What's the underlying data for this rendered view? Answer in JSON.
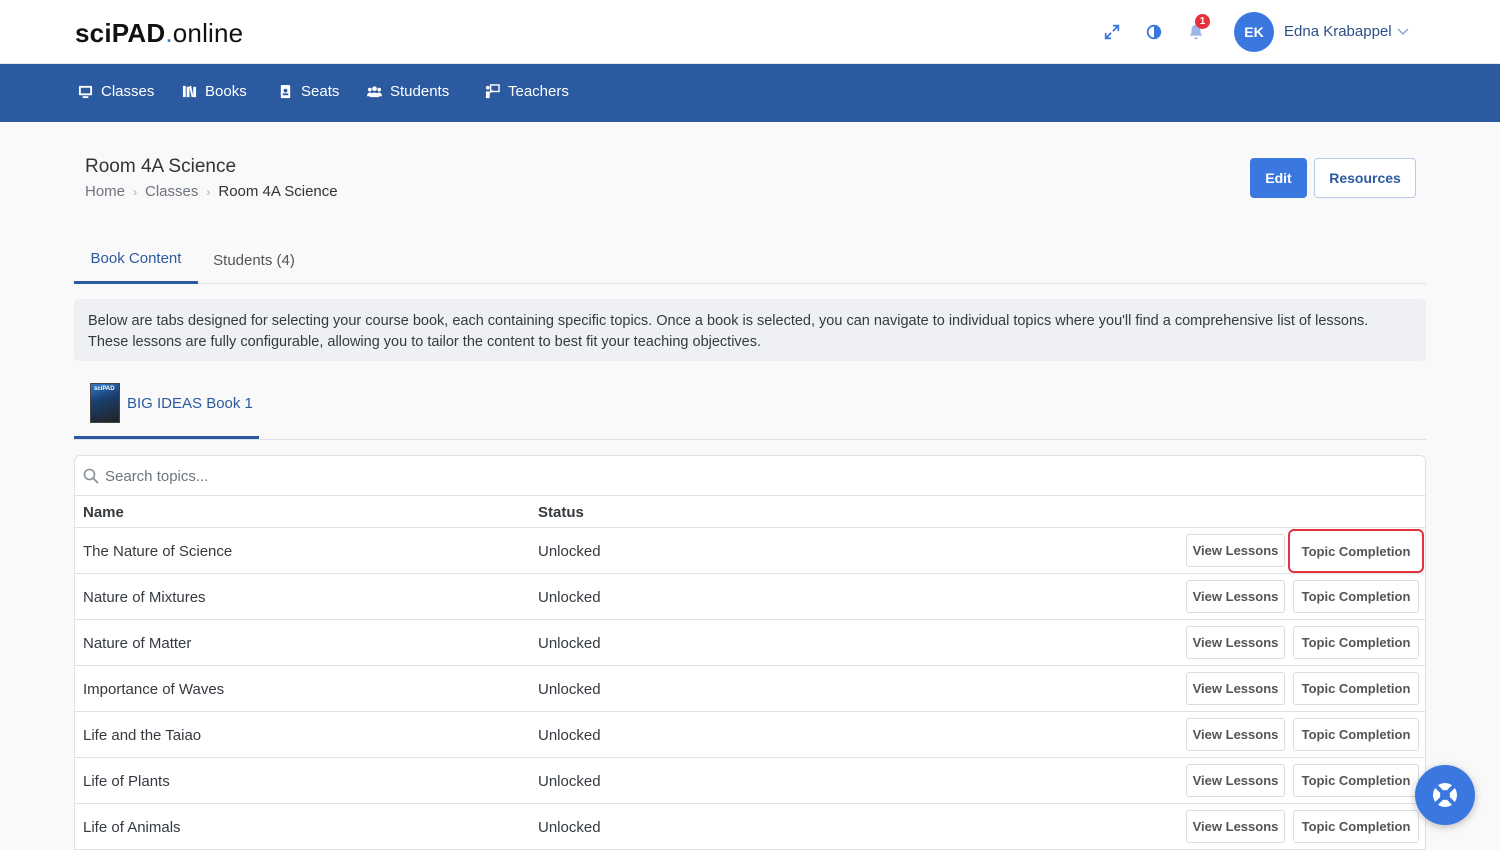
{
  "brand": {
    "part1": "sciPAD",
    "dot": ".",
    "part2": "online"
  },
  "header": {
    "notifications_count": "1",
    "user_initials": "EK",
    "user_name": "Edna Krabappel"
  },
  "nav": {
    "items": [
      {
        "label": "Classes",
        "icon": "classes-icon"
      },
      {
        "label": "Books",
        "icon": "books-icon"
      },
      {
        "label": "Seats",
        "icon": "seats-icon"
      },
      {
        "label": "Students",
        "icon": "students-icon"
      },
      {
        "label": "Teachers",
        "icon": "teachers-icon"
      }
    ]
  },
  "page": {
    "title": "Room 4A Science",
    "breadcrumb": [
      "Home",
      "Classes",
      "Room 4A Science"
    ],
    "edit_label": "Edit",
    "resources_label": "Resources"
  },
  "tabs": [
    {
      "label": "Book Content",
      "active": true
    },
    {
      "label": "Students (4)",
      "active": false
    }
  ],
  "info_text": "Below are tabs designed for selecting your course book, each containing specific topics. Once a book is selected, you can navigate to individual topics where you'll find a comprehensive list of lessons. These lessons are fully configurable, allowing you to tailor the content to best fit your teaching objectives.",
  "book_tab": {
    "label": "BIG IDEAS Book 1",
    "cover_text": "sciPAD"
  },
  "search": {
    "placeholder": "Search topics..."
  },
  "table": {
    "columns": [
      "Name",
      "Status"
    ],
    "view_label": "View Lessons",
    "topic_label": "Topic Completion",
    "rows": [
      {
        "name": "The Nature of Science",
        "status": "Unlocked"
      },
      {
        "name": "Nature of Mixtures",
        "status": "Unlocked"
      },
      {
        "name": "Nature of Matter",
        "status": "Unlocked"
      },
      {
        "name": "Importance of Waves",
        "status": "Unlocked"
      },
      {
        "name": "Life and the Taiao",
        "status": "Unlocked"
      },
      {
        "name": "Life of Plants",
        "status": "Unlocked"
      },
      {
        "name": "Life of Animals",
        "status": "Unlocked"
      }
    ]
  },
  "colors": {
    "primary": "#3a78e0",
    "navbar": "#2c5aa0",
    "highlight": "#e5323c"
  }
}
